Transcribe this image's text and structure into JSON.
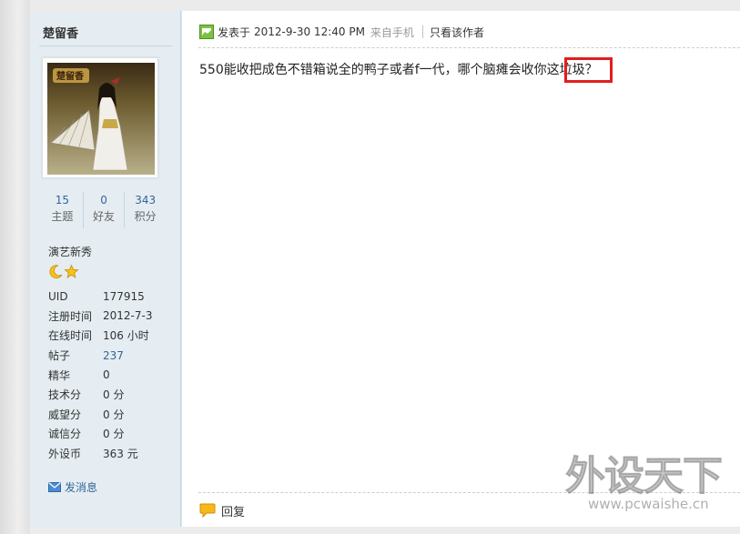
{
  "author": {
    "name": "楚留香",
    "stats": [
      {
        "value": "15",
        "label": "主题"
      },
      {
        "value": "0",
        "label": "好友"
      },
      {
        "value": "343",
        "label": "积分"
      }
    ],
    "rank": "演艺新秀",
    "info": [
      {
        "key": "UID",
        "value": "177915"
      },
      {
        "key": "注册时间",
        "value": "2012-7-3"
      },
      {
        "key": "在线时间",
        "value": "106 小时"
      },
      {
        "key": "帖子",
        "value": "237"
      },
      {
        "key": "精华",
        "value": "0"
      },
      {
        "key": "技术分",
        "value": "0 分"
      },
      {
        "key": "威望分",
        "value": "0 分"
      },
      {
        "key": "诚信分",
        "value": "0 分"
      },
      {
        "key": "外设币",
        "value": "363 元"
      }
    ],
    "send_message": "发消息"
  },
  "post": {
    "posted_label": "发表于",
    "datetime": "2012-9-30 12:40 PM",
    "source": "来自手机",
    "only_author": "只看该作者",
    "body": "550能收把成色不错箱说全的鸭子或者f一代，哪个脑瘫会收你这垃圾？",
    "reply_label": "回复"
  },
  "watermark": {
    "title": "外设天下",
    "url": "www.pcwaishe.cn"
  },
  "colors": {
    "sidebar_bg": "#e5edf2",
    "link": "#336699",
    "highlight_box": "#e31d1d"
  },
  "icons": {
    "post_icon": "green-post-icon",
    "rank_icons": [
      "moon-icon",
      "star-icon"
    ],
    "message_icon": "envelope-icon",
    "reply_icon": "speech-bubble-icon"
  }
}
